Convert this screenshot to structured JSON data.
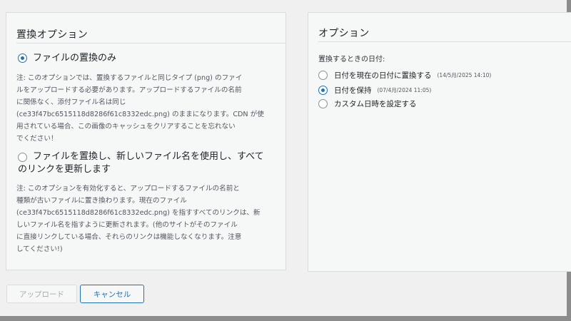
{
  "replace_options": {
    "title": "置換オプション",
    "option1_label": "ファイルの置換のみ",
    "option1_note": [
      "注: このオプションでは、置換するファイルと同じタイプ (png) のファイ",
      "ルをアップロードする必要があります。アップロードするファイルの名前",
      "に関係なく、添付ファイル名は同じ",
      "(ce33f47bc6515118d8286f61c8332edc.png) のままになります。CDN が使",
      "用されている場合、この画像のキャッシュをクリアすることを忘れない",
      "でください！"
    ],
    "option2_label_line1": "ファイルを置換し、新しいファイル名を使用し、すべて",
    "option2_label_line2": "のリンクを更新します",
    "option2_note": [
      "注: このオプションを有効化すると、アップロードするファイルの名前と",
      "種類が古いファイルに置き換わります。現在のファイル",
      "(ce33f47bc6515118d8286f61c8332edc.png) を指すすべてのリンクは、新",
      "しいファイル名を指すように更新されます。(他のサイトがそのファイル",
      "に直接リンクしている場合、それらのリンクは機能しなくなります。注意",
      "してください!)"
    ],
    "selected": "option1"
  },
  "options": {
    "title": "オプション",
    "date_label": "置換するときの日付:",
    "date_options": [
      {
        "label": "日付を現在の日付に置換する",
        "detail": "(14/5月/2025 14:10)",
        "checked": false
      },
      {
        "label": "日付を保持",
        "detail": "(07/4月/2024 11:05)",
        "checked": true
      },
      {
        "label": "カスタム日時を設定する",
        "detail": "",
        "checked": false
      }
    ]
  },
  "buttons": {
    "upload": "アップロード",
    "cancel": "キャンセル"
  }
}
